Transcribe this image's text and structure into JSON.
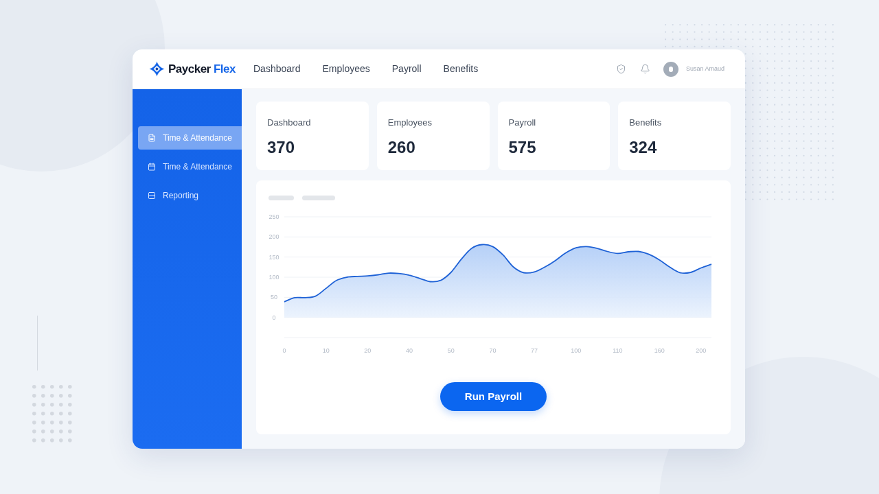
{
  "brand": {
    "name": "Paycker",
    "name_accent": "Flex"
  },
  "nav": [
    {
      "label": "Dashboard"
    },
    {
      "label": "Employees"
    },
    {
      "label": "Payroll"
    },
    {
      "label": "Benefits"
    }
  ],
  "user": {
    "name": "Susan Amaud"
  },
  "sidebar": {
    "items": [
      {
        "label": "Time & Attendance",
        "selected": true
      },
      {
        "label": "Time & Attendance",
        "selected": false
      },
      {
        "label": "Reporting",
        "selected": false
      }
    ]
  },
  "stats": [
    {
      "label": "Dashboard",
      "value": "370"
    },
    {
      "label": "Employees",
      "value": "260"
    },
    {
      "label": "Payroll",
      "value": "575"
    },
    {
      "label": "Benefits",
      "value": "324"
    }
  ],
  "chart_panel": {
    "chart_data": {
      "type": "area",
      "categories": [
        "0",
        null,
        null,
        null,
        "10",
        null,
        null,
        null,
        "20",
        null,
        null,
        null,
        "40",
        null,
        null,
        null,
        "50",
        null,
        null,
        null,
        "70",
        null,
        null,
        null,
        "77",
        null,
        null,
        null,
        "100",
        null,
        null,
        null,
        "110",
        null,
        null,
        null,
        "160",
        null,
        null,
        null,
        "200",
        null
      ],
      "values": [
        39,
        49,
        49,
        53,
        72,
        92,
        100,
        102,
        103,
        106,
        110,
        109,
        105,
        97,
        89,
        92,
        112,
        145,
        172,
        181,
        176,
        155,
        125,
        111,
        113,
        125,
        141,
        160,
        173,
        176,
        172,
        164,
        159,
        163,
        164,
        157,
        143,
        125,
        111,
        112,
        123,
        132
      ],
      "ylim": [
        -50,
        250
      ],
      "yticks": [
        0,
        50,
        100,
        150,
        200,
        250
      ],
      "grid": true
    },
    "button": {
      "label": "Run Payroll"
    }
  }
}
